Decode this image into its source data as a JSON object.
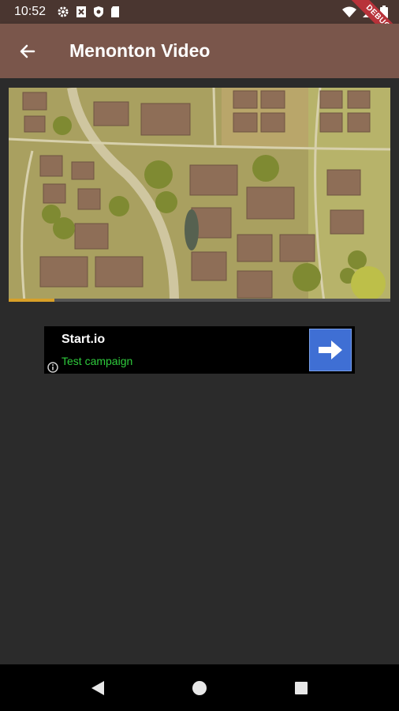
{
  "status_bar": {
    "time": "10:52",
    "left_icons": [
      "settings-icon",
      "sim-icon",
      "shield-icon",
      "sd-card-icon"
    ],
    "right_icons": [
      "wifi-icon",
      "signal-icon",
      "battery-icon"
    ],
    "debug_label": "DEBUG"
  },
  "app_bar": {
    "title": "Menonton Video",
    "back_icon": "arrow-back-icon"
  },
  "video": {
    "progress_fraction": 0.12
  },
  "ad": {
    "title": "Start.io",
    "subtitle": "Test campaign",
    "subtitle_color": "#2ecb3c",
    "cta_icon": "arrow-right-icon",
    "cta_color": "#3f6fd4"
  },
  "nav_bar": {
    "icons": [
      "back-triangle-icon",
      "home-circle-icon",
      "recents-square-icon"
    ]
  },
  "colors": {
    "app_bar": "#7a564b",
    "status_bar": "#4a3630",
    "background": "#2b2b2b"
  }
}
